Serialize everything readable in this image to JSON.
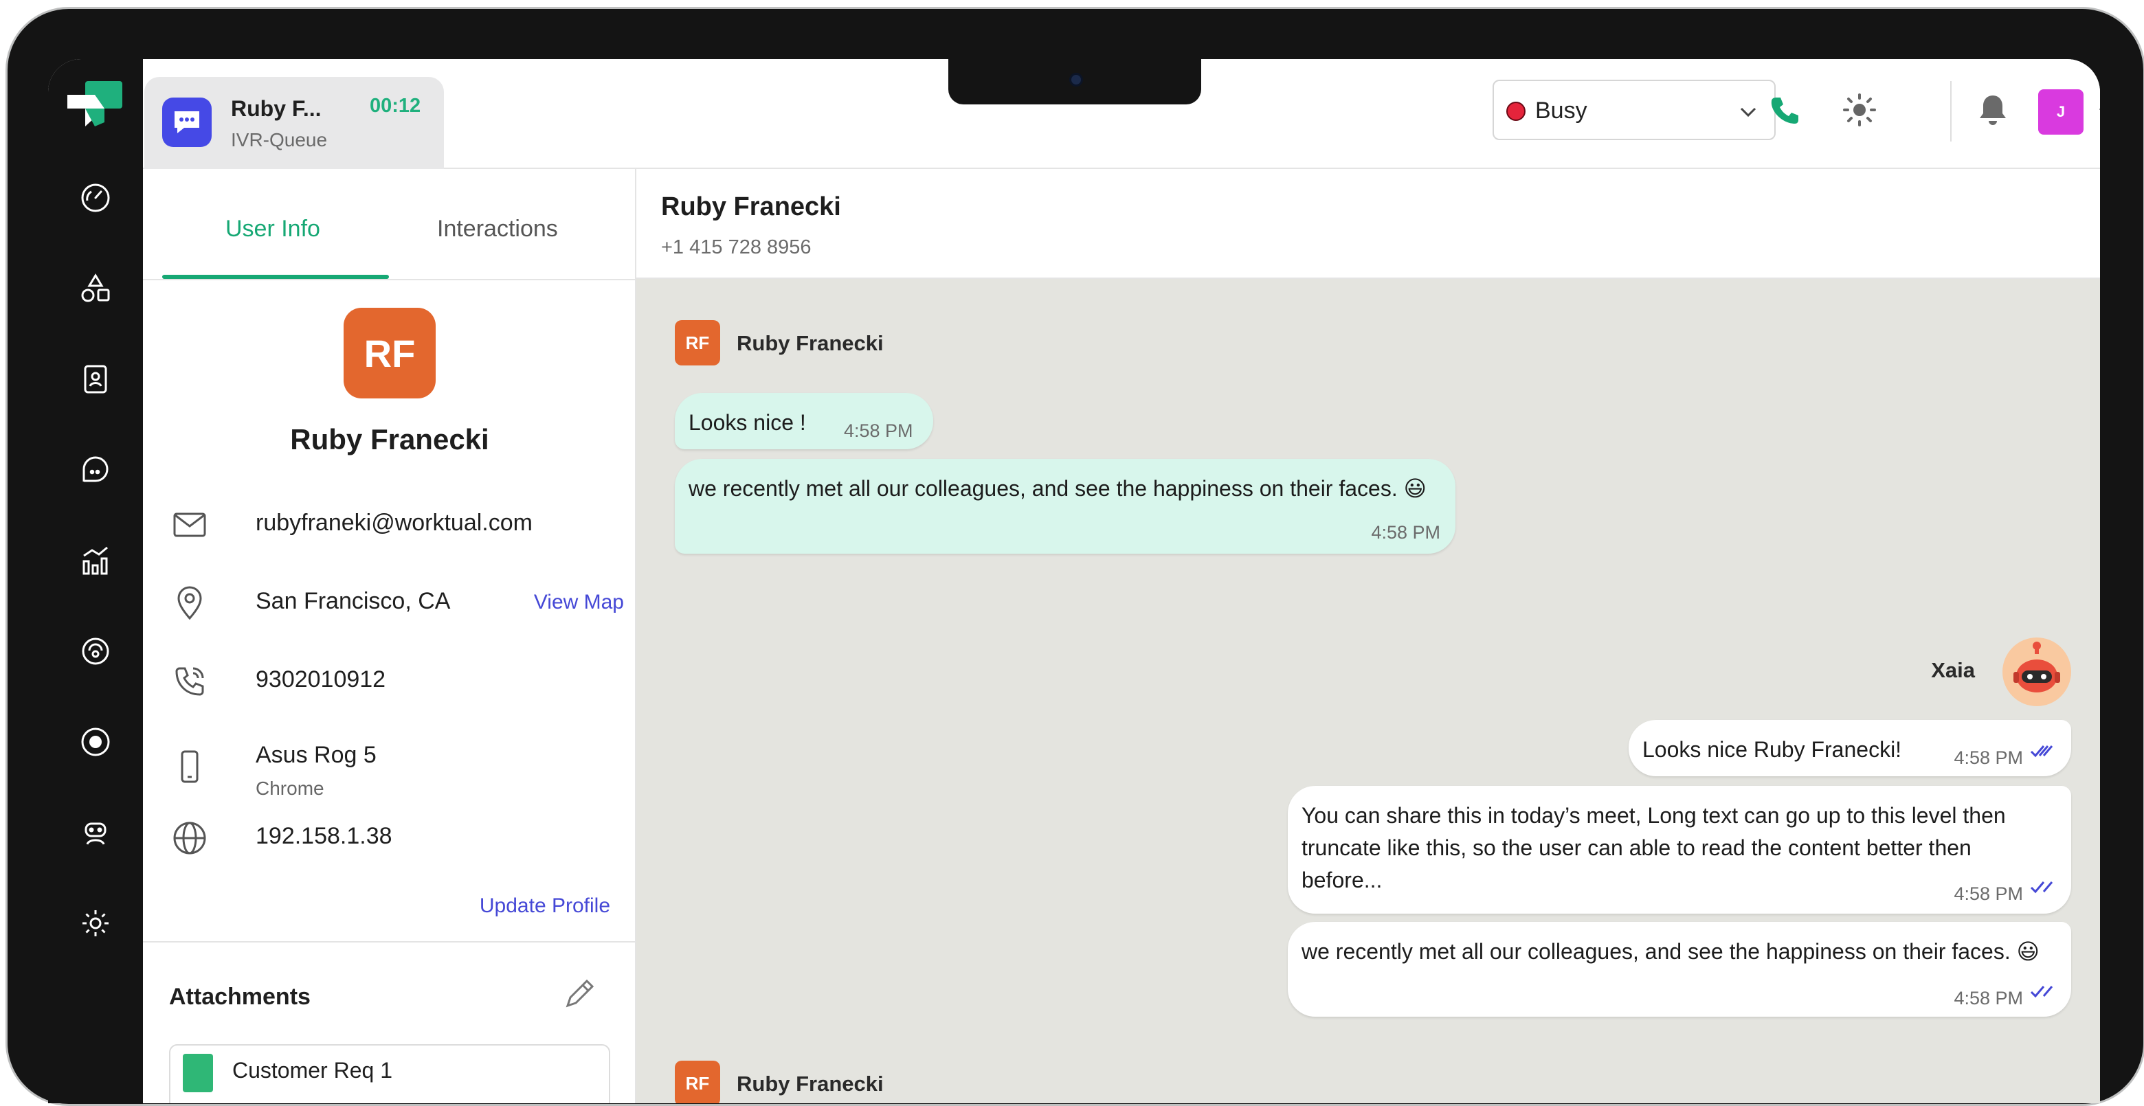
{
  "active_call": {
    "name": "Ruby F...",
    "queue": "IVR-Queue",
    "timer": "00:12"
  },
  "status": {
    "label": "Busy",
    "color": "#e5243b"
  },
  "user_menu": {
    "initial": "J"
  },
  "tabs": {
    "user_info": "User Info",
    "interactions": "Interactions"
  },
  "profile": {
    "initials": "RF",
    "name": "Ruby Franecki",
    "email": "rubyfraneki@worktual.com",
    "location": "San Francisco, CA",
    "view_map": "View Map",
    "phone": "9302010912",
    "device": "Asus Rog 5",
    "browser": "Chrome",
    "ip": "192.158.1.38",
    "update_profile": "Update Profile"
  },
  "attachments": {
    "title": "Attachments",
    "items": [
      {
        "name": "Customer Req 1"
      }
    ]
  },
  "chat": {
    "header_name": "Ruby Franecki",
    "header_phone": "+1 415 728 8956",
    "contact_initials": "RF",
    "contact_name": "Ruby Franecki",
    "agent_name": "Xaia",
    "messages": [
      {
        "text": "Looks nice !",
        "time": "4:58 PM"
      },
      {
        "text": "we recently met all our colleagues, and see the happiness on their faces. 😃",
        "time": "4:58 PM"
      },
      {
        "text": "Looks nice Ruby Franecki!",
        "time": "4:58 PM"
      },
      {
        "text": "You can share this in today’s meet, Long text can go up to this level then truncate like this, so the user can able to read the content better then before...",
        "time": "4:58 PM"
      },
      {
        "text": "we recently met all our colleagues, and see the happiness on their faces. 😃",
        "time": "4:58 PM"
      }
    ]
  },
  "colors": {
    "accent": "#16a874",
    "link": "#4548d6",
    "incoming_bubble": "#d8f6ec",
    "avatar_orange": "#e3672e"
  }
}
